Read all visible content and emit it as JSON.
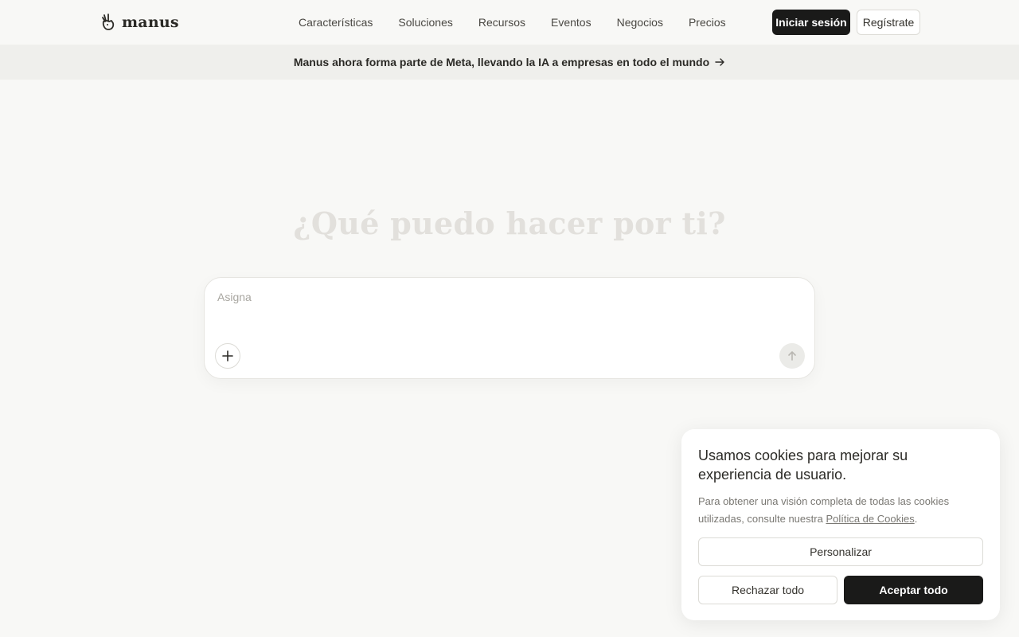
{
  "brand": {
    "name": "manus",
    "logo_icon": "hand-peace-icon"
  },
  "nav": {
    "items": [
      {
        "label": "Características"
      },
      {
        "label": "Soluciones"
      },
      {
        "label": "Recursos"
      },
      {
        "label": "Eventos"
      },
      {
        "label": "Negocios"
      },
      {
        "label": "Precios"
      }
    ],
    "login_label": "Iniciar sesión",
    "register_label": "Regístrate"
  },
  "banner": {
    "text": "Manus ahora forma parte de Meta, llevando la IA a empresas en todo el mundo",
    "icon": "arrow-right-icon"
  },
  "hero": {
    "title": "¿Qué puedo hacer por ti?"
  },
  "composer": {
    "placeholder": "Asigna",
    "value": "",
    "add_icon": "plus-icon",
    "send_icon": "arrow-up-icon"
  },
  "cookie": {
    "title": "Usamos cookies para mejorar su experiencia de usuario.",
    "desc_before": "Para obtener una visión completa de todas las cookies utilizadas, consulte nuestra",
    "link_text": "Política de Cookies",
    "desc_after": ".",
    "customize_label": "Personalizar",
    "reject_label": "Rechazar todo",
    "accept_label": "Aceptar todo"
  },
  "colors": {
    "background": "#f8f8f6",
    "banner_bg": "#efefec",
    "primary_button": "#1a1a19",
    "hero_text": "#e2e0dc"
  }
}
